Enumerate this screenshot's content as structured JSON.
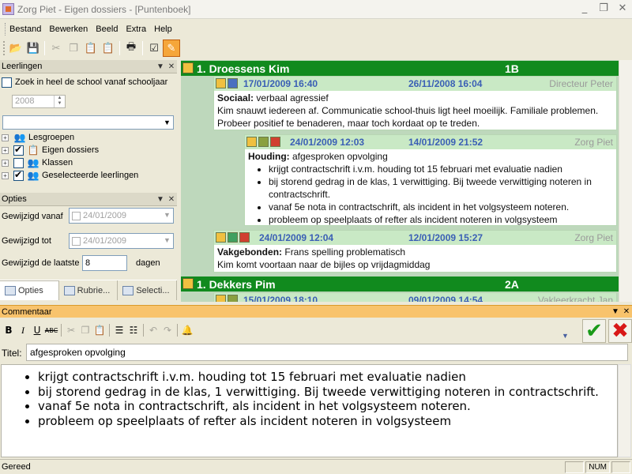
{
  "window": {
    "title": "Zorg Piet - Eigen dossiers - [Puntenboek]",
    "min": "_",
    "restore": "❐",
    "close": "✕"
  },
  "menu": [
    "Bestand",
    "Bewerken",
    "Beeld",
    "Extra",
    "Help"
  ],
  "leerlingen": {
    "title": "Leerlingen",
    "search_label": "Zoek in heel de school vanaf schooljaar",
    "year": "2008",
    "tree": [
      {
        "label": "Lesgroepen",
        "checked": false
      },
      {
        "label": "Eigen dossiers",
        "checked": true
      },
      {
        "label": "Klassen",
        "checked": false
      },
      {
        "label": "Geselecteerde leerlingen",
        "checked": true
      }
    ]
  },
  "opties": {
    "title": "Opties",
    "gewijzigd_vanaf_label": "Gewijzigd vanaf",
    "gewijzigd_vanaf": "24/01/2009",
    "gewijzigd_tot_label": "Gewijzigd tot",
    "gewijzigd_tot": "24/01/2009",
    "laatste_label": "Gewijzigd de laatste",
    "laatste_value": "8",
    "laatste_unit": "dagen",
    "tabs": [
      "Opties",
      "Rubrie...",
      "Selecti..."
    ]
  },
  "students": [
    {
      "name": "1. Droessens Kim",
      "class": "1B",
      "entries": [
        {
          "date": "17/01/2009 16:40",
          "date2": "26/11/2008 16:04",
          "author": "Directeur Peter",
          "category": "Sociaal:",
          "subject": "verbaal agressief",
          "text": "Kim snauwt iedereen af. Communicatie school-thuis ligt heel moeilijk. Familiale problemen. Probeer positief te benaderen, maar toch kordaat op te treden."
        },
        {
          "date": "24/01/2009 12:03",
          "date2": "14/01/2009 21:52",
          "author": "Zorg Piet",
          "category": "Houding:",
          "subject": "afgesproken opvolging",
          "bullets": [
            "krijgt contractschrift i.v.m. houding tot 15 februari met evaluatie nadien",
            "bij storend gedrag in de klas, 1 verwittiging. Bij tweede verwittiging noteren in contractschrift.",
            "vanaf 5e nota in contractschrift, als incident in het volgsysteem noteren.",
            "probleem op speelplaats of refter als incident noteren in volgsysteem"
          ]
        },
        {
          "date": "24/01/2009 12:04",
          "date2": "12/01/2009 15:27",
          "author": "Zorg Piet",
          "category": "Vakgebonden:",
          "subject": "Frans spelling problematisch",
          "text": "Kim komt voortaan naar de bijles op vrijdagmiddag"
        }
      ]
    },
    {
      "name": "1. Dekkers Pim",
      "class": "2A",
      "entries": [
        {
          "date": "15/01/2009 18:10",
          "date2": "09/01/2009 14:54",
          "author": "Vakleerkracht Jan"
        }
      ]
    }
  ],
  "commentaar": {
    "title": "Commentaar",
    "titel_label": "Titel:",
    "titel_value": "afgesproken opvolging",
    "bullets": [
      "krijgt contractschrift i.v.m. houding tot 15 februari met evaluatie nadien",
      "bij storend gedrag in de klas, 1 verwittiging. Bij tweede verwittiging noteren in contractschrift.",
      "vanaf 5e nota in contractschrift, als incident in het volgsysteem noteren.",
      "probleem op speelplaats of refter als incident noteren in volgsysteem"
    ]
  },
  "status": {
    "text": "Gereed",
    "num": "NUM"
  },
  "colors": {
    "student_bar": "#118a1e",
    "card_head": "#c9e9c5",
    "comment_bar": "#f8c36c",
    "date_blue": "#3a5fb5"
  }
}
